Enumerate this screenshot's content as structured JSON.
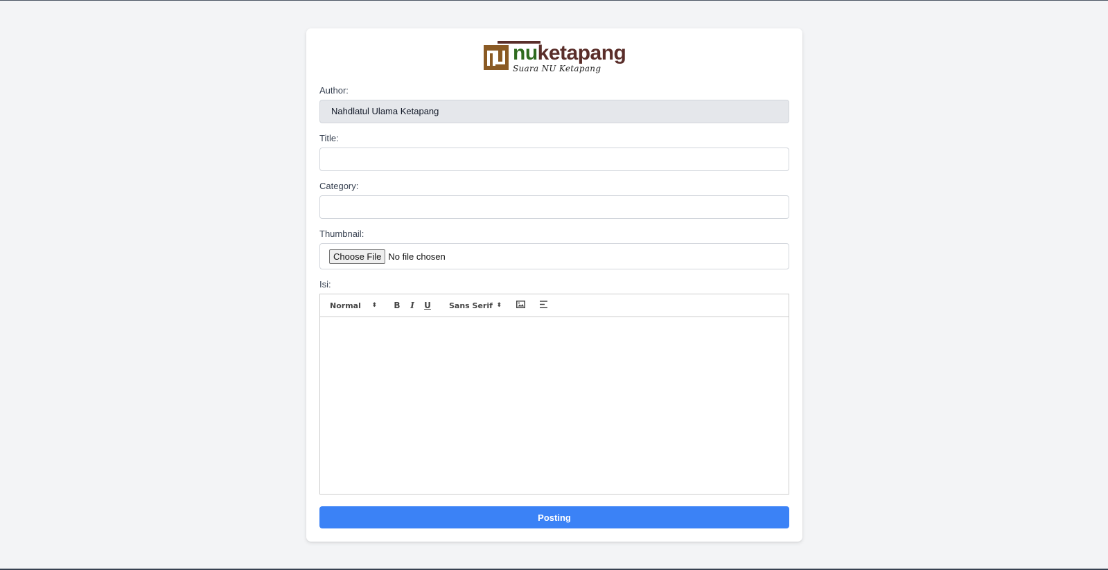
{
  "brand": {
    "logo_mark": "NU",
    "name_part1": "nu",
    "name_part2": "ketapang",
    "tagline": "Suara NU Ketapang"
  },
  "form": {
    "author": {
      "label": "Author:",
      "value": "Nahdlatul Ulama Ketapang"
    },
    "title": {
      "label": "Title:",
      "value": ""
    },
    "category": {
      "label": "Category:",
      "value": ""
    },
    "thumbnail": {
      "label": "Thumbnail:",
      "button": "Choose File",
      "status": "No file chosen"
    },
    "isi": {
      "label": "Isi:"
    },
    "toolbar": {
      "header_select": "Normal",
      "font_select": "Sans Serif",
      "bold": "B",
      "italic": "I",
      "underline": "U",
      "image_icon": "image-icon",
      "align_icon": "align-left-icon"
    },
    "submit": "Posting"
  },
  "colors": {
    "primary": "#3b82f6",
    "brand_green": "#2f6b1f",
    "brand_maroon": "#5a2e2a",
    "background": "#f3f4f6"
  }
}
